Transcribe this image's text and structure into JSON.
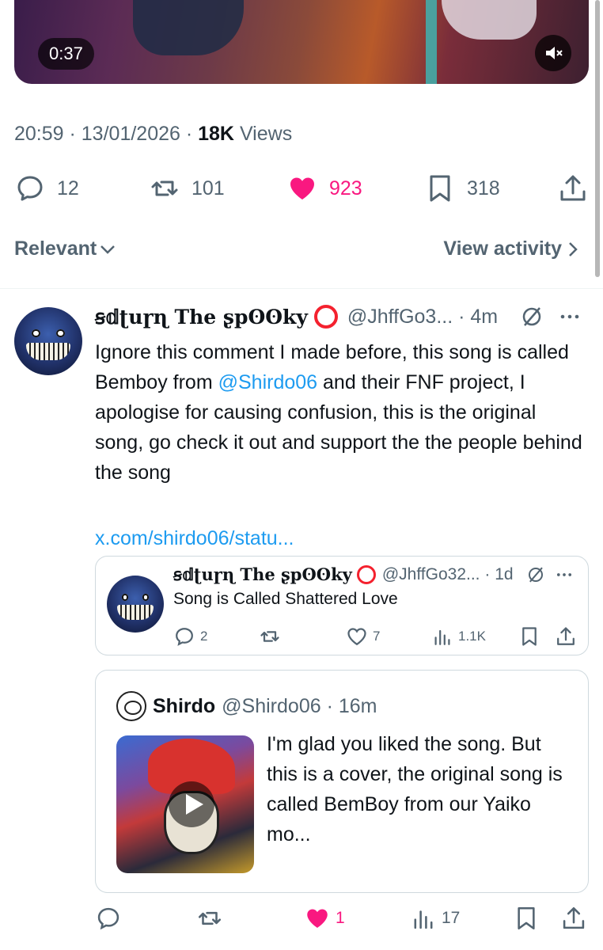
{
  "video": {
    "duration": "0:37"
  },
  "tweet": {
    "time": "20:59",
    "date": "13/01/2026",
    "views_count": "18K",
    "views_label": "Views",
    "replies": "12",
    "reposts": "101",
    "likes": "923",
    "bookmarks": "318"
  },
  "filter": {
    "label": "Relevant",
    "view_activity": "View activity"
  },
  "reply": {
    "name": "ꞩ𝕕ʈuɼɳ The ʂpʘʘky",
    "handle": "@JhffGo3...",
    "time": "4m",
    "body_1": "Ignore this comment I made before, this song is called Bemboy from ",
    "mention": "@Shirdo06",
    "body_2": " and their FNF project, I apologise for causing confusion, this is the original song, go check it out and support the the people behind the song",
    "url": "x.com/shirdo06/statu..."
  },
  "quote1": {
    "name": "ꞩ𝕕ʈuɼɳ The ʂpʘʘky",
    "handle": "@JhffGo32...",
    "time": "1d",
    "body": "Song is Called Shattered Love",
    "replies": "2",
    "likes": "7",
    "views": "1.1K"
  },
  "quote2": {
    "name": "Shirdo",
    "handle": "@Shirdo06",
    "time": "16m",
    "body": "I'm glad you liked the song. But this is a cover, the original song is called BemBoy from our Yaiko mo..."
  },
  "bottom": {
    "likes": "1",
    "views": "17"
  },
  "colors": {
    "like": "#f91880",
    "link": "#1d9bf0",
    "muted": "#536471",
    "text": "#0f1419"
  }
}
